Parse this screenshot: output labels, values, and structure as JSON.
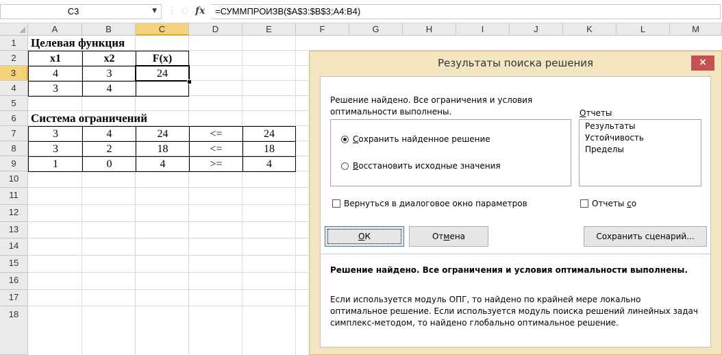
{
  "formula_bar": {
    "name_box": "C3",
    "fx_label": "fx",
    "formula": "=СУММПРОИЗВ($A$3:$B$3;A4:B4)"
  },
  "columns": [
    "A",
    "B",
    "C",
    "D",
    "E",
    "F",
    "G",
    "H",
    "I",
    "J",
    "K",
    "L",
    "M"
  ],
  "selected_column": "C",
  "rows": [
    "1",
    "2",
    "3",
    "4",
    "5",
    "6",
    "7",
    "8",
    "9",
    "10",
    "11",
    "12",
    "13",
    "14",
    "15",
    "16",
    "17",
    "18"
  ],
  "selected_row": "3",
  "sheet": {
    "objective_title": "Целевая функция",
    "objective_headers": [
      "x1",
      "x2",
      "F(x)"
    ],
    "objective_row3": [
      "4",
      "3",
      "24"
    ],
    "objective_row4": [
      "3",
      "4",
      ""
    ],
    "constraints_title": "Система ограничений",
    "constraints": [
      [
        "3",
        "4",
        "24",
        "<=",
        "24"
      ],
      [
        "3",
        "2",
        "18",
        "<=",
        "18"
      ],
      [
        "1",
        "0",
        "4",
        ">=",
        "4"
      ]
    ]
  },
  "dialog": {
    "title": "Результаты поиска решения",
    "close_label": "×",
    "status_line1": "Решение найдено. Все ограничения и условия",
    "status_line2": "оптимальности выполнены.",
    "keep_solution_prefix": "С",
    "keep_solution_rest": "охранить найденное решение",
    "restore_prefix": "В",
    "restore_rest": "осстановить исходные значения",
    "reports_label_prefix": "О",
    "reports_label_rest": "тчеты",
    "reports": [
      "Результаты",
      "Устойчивость",
      "Пределы"
    ],
    "return_dialog_a": "Вернуться в диалоговое окно параметров",
    "outline_reports_a": "Отчеты ",
    "outline_reports_b": "с",
    "outline_reports_c": "о",
    "ok_prefix": "О",
    "ok_rest": "К",
    "cancel_a": "От",
    "cancel_b": "м",
    "cancel_c": "ена",
    "save_scenario_a": "Сохранить сценарий...",
    "message_bold": "Решение найдено. Все ограничения и условия оптимальности выполнены.",
    "message_line1": "Если используется модуль ОПГ, то найдено по крайней мере локально",
    "message_line2": "оптимальное решение. Если используется модуль поиска решений линейных задач",
    "message_line3": "симплекс-методом, то найдено глобально оптимальное решение."
  }
}
